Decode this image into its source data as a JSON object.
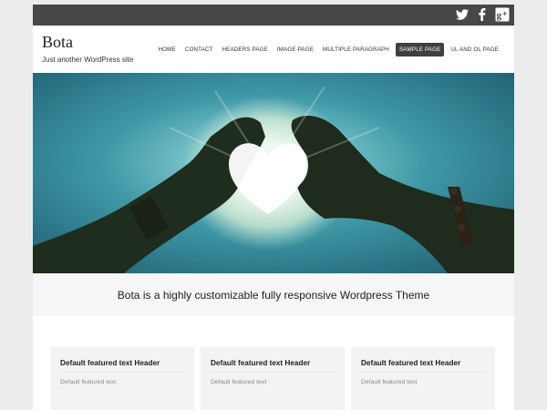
{
  "site": {
    "title": "Bota",
    "description": "Just another WordPress site"
  },
  "social": [
    {
      "icon": "twitter-icon"
    },
    {
      "icon": "facebook-icon"
    },
    {
      "icon": "google-plus-icon"
    }
  ],
  "nav": {
    "items": [
      {
        "label": "HOME"
      },
      {
        "label": "CONTACT"
      },
      {
        "label": "HEADERS PAGE"
      },
      {
        "label": "IMAGE PAGE"
      },
      {
        "label": "MULTIPLE PARAGRAPH"
      },
      {
        "label": "SAMPLE PAGE",
        "active": true
      },
      {
        "label": "UL AND OL PAGE"
      }
    ]
  },
  "hero": {
    "image": "heart-hands-sun-photo"
  },
  "tagline": "Bota is a highly customizable fully responsive Wordpress Theme",
  "features": [
    {
      "header": "Default featured text Header",
      "text": "Default featured text"
    },
    {
      "header": "Default featured text Header",
      "text": "Default featured text"
    },
    {
      "header": "Default featured text Header",
      "text": "Default featured text"
    }
  ],
  "colors": {
    "topbar": "#474747",
    "active_nav": "#3f3f3f",
    "body_bg": "#ececec",
    "sky": "#3d8fa0"
  }
}
